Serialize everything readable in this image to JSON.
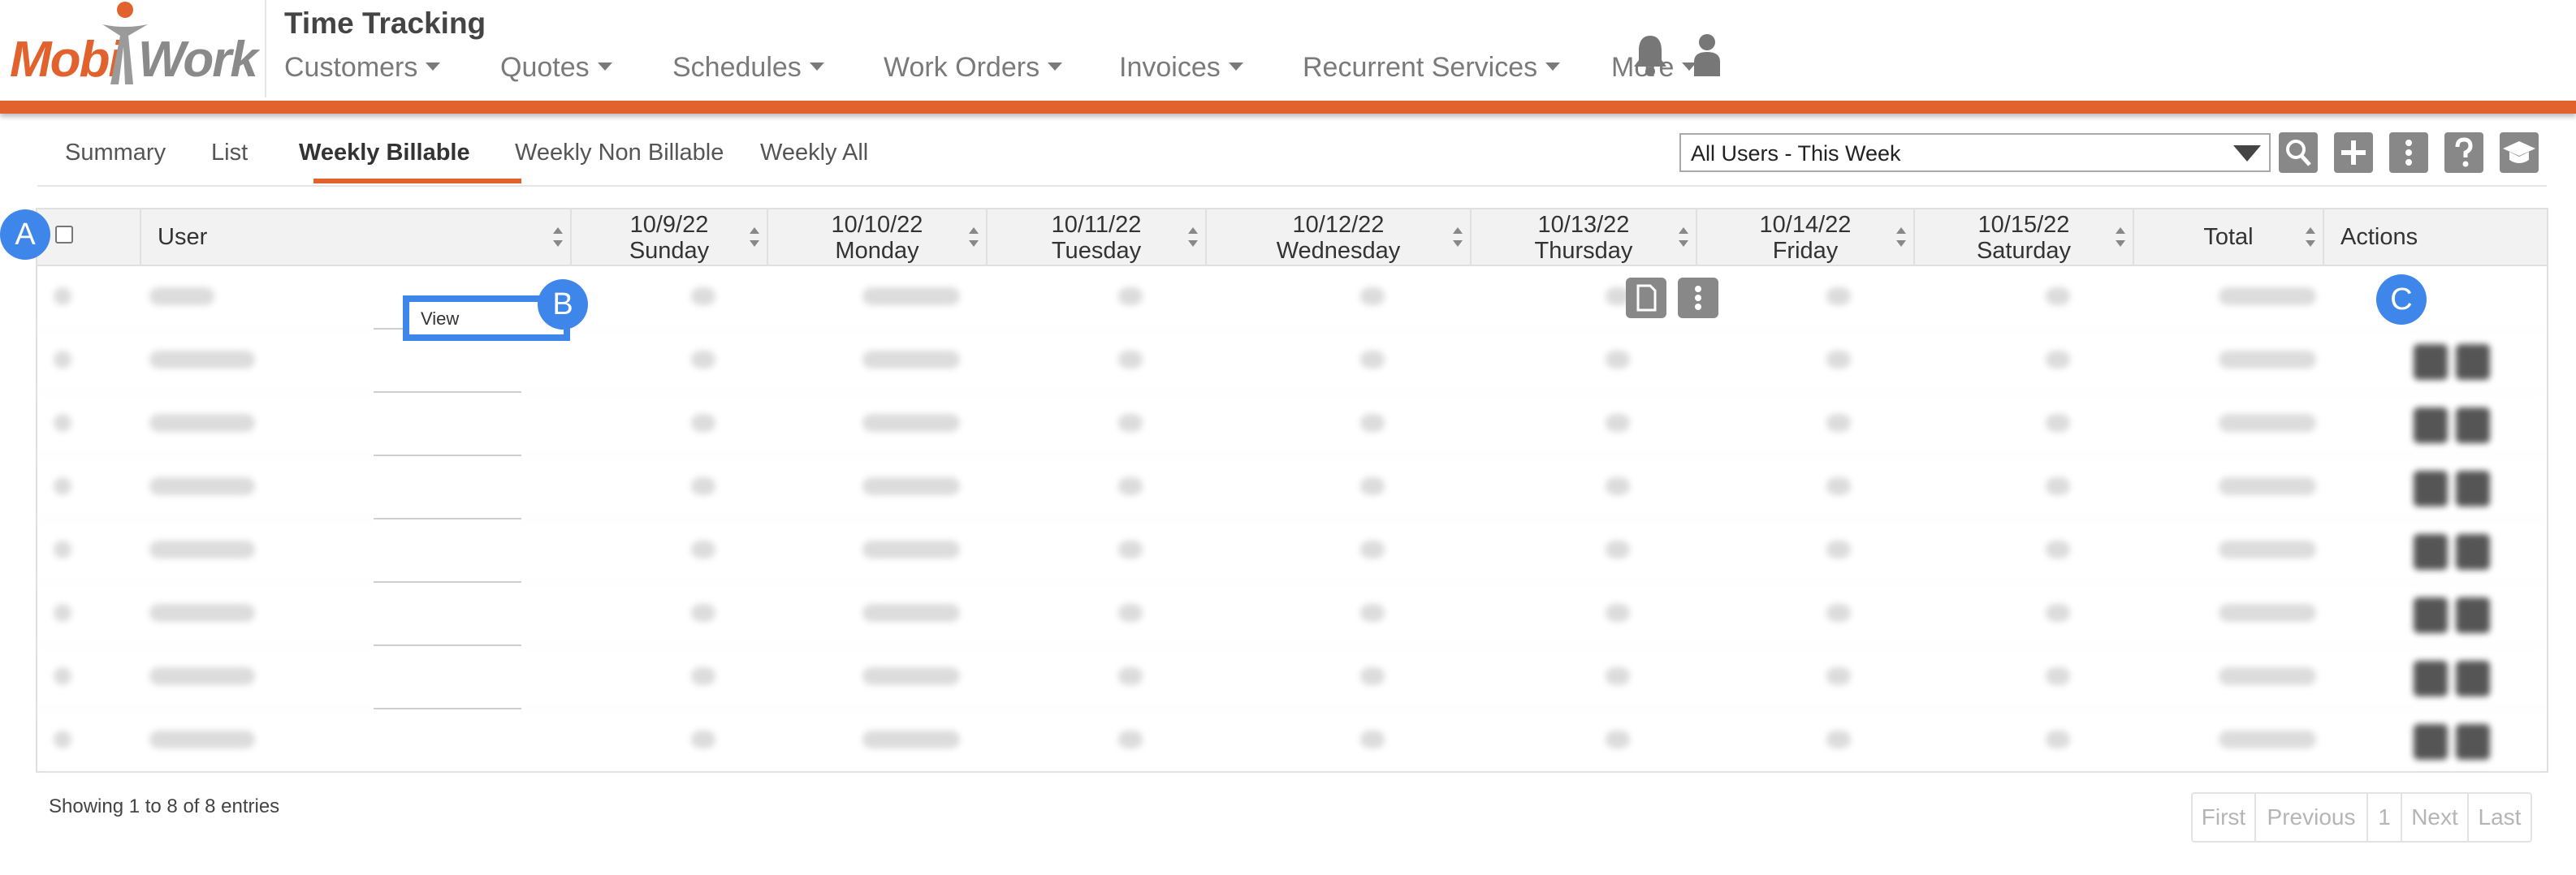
{
  "brand": {
    "logo_left": "Mobi",
    "logo_right": "Work",
    "accent": "#e2622e"
  },
  "app_title": "Time Tracking",
  "nav": [
    {
      "label": "Customers"
    },
    {
      "label": "Quotes"
    },
    {
      "label": "Schedules"
    },
    {
      "label": "Work Orders"
    },
    {
      "label": "Invoices"
    },
    {
      "label": "Recurrent Services"
    },
    {
      "label": "More"
    }
  ],
  "header_icons": [
    "bell-icon",
    "user-icon"
  ],
  "tabs": [
    {
      "label": "Summary"
    },
    {
      "label": "List"
    },
    {
      "label": "Weekly Billable",
      "active": true
    },
    {
      "label": "Weekly Non Billable"
    },
    {
      "label": "Weekly All"
    }
  ],
  "filter": {
    "value": "All Users - This Week"
  },
  "toolbar_icons": [
    "search-icon",
    "plus-icon",
    "more-vertical-icon",
    "help-icon",
    "graduation-cap-icon"
  ],
  "table": {
    "columns": [
      {
        "key": "select",
        "line1": "",
        "line2": ""
      },
      {
        "key": "user",
        "line1": "User",
        "line2": ""
      },
      {
        "key": "sun",
        "line1": "10/9/22",
        "line2": "Sunday"
      },
      {
        "key": "mon",
        "line1": "10/10/22",
        "line2": "Monday"
      },
      {
        "key": "tue",
        "line1": "10/11/22",
        "line2": "Tuesday"
      },
      {
        "key": "wed",
        "line1": "10/12/22",
        "line2": "Wednesday"
      },
      {
        "key": "thu",
        "line1": "10/13/22",
        "line2": "Thursday"
      },
      {
        "key": "fri",
        "line1": "10/14/22",
        "line2": "Friday"
      },
      {
        "key": "sat",
        "line1": "10/15/22",
        "line2": "Saturday"
      },
      {
        "key": "total",
        "line1": "Total",
        "line2": ""
      },
      {
        "key": "actions",
        "line1": "Actions",
        "line2": ""
      }
    ],
    "row_count": 8,
    "rows_obscured": true
  },
  "dropdown": {
    "item": "View"
  },
  "markers": {
    "a": "A",
    "b": "B",
    "c": "C"
  },
  "footer": {
    "showing": "Showing 1 to 8 of 8 entries",
    "pager": [
      "First",
      "Previous",
      "1",
      "Next",
      "Last"
    ]
  }
}
